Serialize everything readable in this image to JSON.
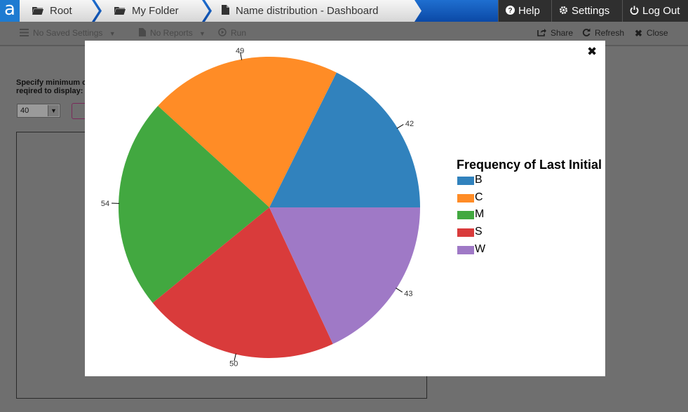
{
  "header": {
    "logo": "a",
    "breadcrumbs": [
      {
        "label": "Root",
        "icon": "folder-icon"
      },
      {
        "label": "My Folder",
        "icon": "folder-icon"
      },
      {
        "label": "Name distribution - Dashboard",
        "icon": "document-icon"
      }
    ],
    "help_label": "Help",
    "settings_label": "Settings",
    "logout_label": "Log Out"
  },
  "toolbar": {
    "saved_settings": "No Saved Settings",
    "reports": "No Reports",
    "run": "Run",
    "share": "Share",
    "refresh": "Refresh",
    "close": "Close"
  },
  "form": {
    "label": "Specify minimum c... reqired to display:",
    "label_line1": "Specify minimum c",
    "label_line2": "reqired to display:",
    "min_value": "40"
  },
  "modal": {
    "close_glyph": "✖"
  },
  "chart_data": {
    "type": "pie",
    "legend_title": "Frequency of Last Initial",
    "legend_position": "right",
    "categories": [
      "B",
      "C",
      "M",
      "S",
      "W"
    ],
    "values": [
      42,
      49,
      54,
      50,
      43
    ],
    "colors": [
      "#3182bd",
      "#ff8c26",
      "#42a840",
      "#d93b3b",
      "#9f79c6"
    ]
  }
}
